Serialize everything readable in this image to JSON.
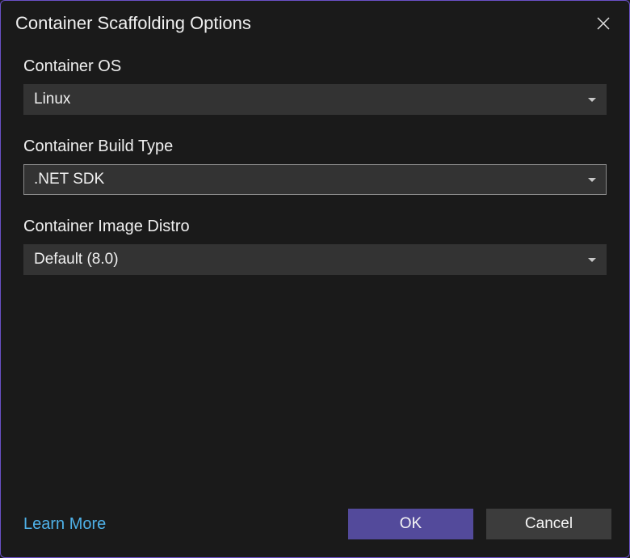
{
  "dialog": {
    "title": "Container Scaffolding Options"
  },
  "fields": {
    "containerOS": {
      "label": "Container OS",
      "value": "Linux"
    },
    "buildType": {
      "label": "Container Build Type",
      "value": ".NET SDK"
    },
    "imageDistro": {
      "label": "Container Image Distro",
      "value": "Default (8.0)"
    }
  },
  "footer": {
    "learnMore": "Learn More",
    "ok": "OK",
    "cancel": "Cancel"
  }
}
